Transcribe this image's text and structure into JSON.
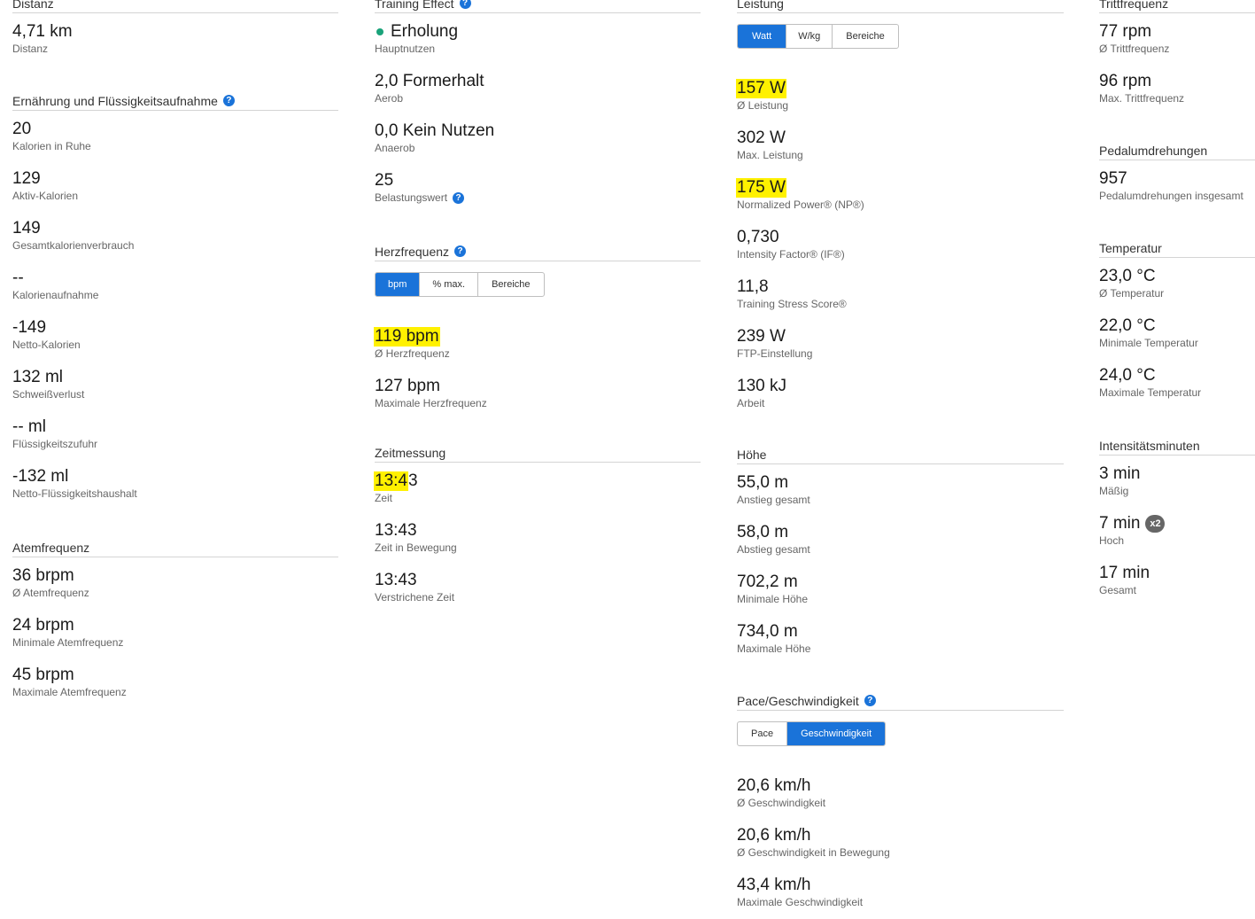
{
  "col1": {
    "distanz": {
      "title": "Distanz",
      "stats": [
        {
          "value": "4,71 km",
          "label": "Distanz"
        }
      ]
    },
    "ernaehrung": {
      "title": "Ernährung und Flüssigkeitsaufnahme",
      "help": "?",
      "stats": [
        {
          "value": "20",
          "label": "Kalorien in Ruhe"
        },
        {
          "value": "129",
          "label": "Aktiv-Kalorien"
        },
        {
          "value": "149",
          "label": "Gesamtkalorienverbrauch"
        },
        {
          "value": "--",
          "label": "Kalorienaufnahme"
        },
        {
          "value": "-149",
          "label": "Netto-Kalorien"
        },
        {
          "value": "132 ml",
          "label": "Schweißverlust"
        },
        {
          "value": "-- ml",
          "label": "Flüssigkeitszufuhr"
        },
        {
          "value": "-132 ml",
          "label": "Netto-Flüssigkeitshaushalt"
        }
      ]
    },
    "atem": {
      "title": "Atemfrequenz",
      "stats": [
        {
          "value": "36 brpm",
          "label": "Ø Atemfrequenz"
        },
        {
          "value": "24 brpm",
          "label": "Minimale Atemfrequenz"
        },
        {
          "value": "45 brpm",
          "label": "Maximale Atemfrequenz"
        }
      ]
    }
  },
  "col2": {
    "training": {
      "title": "Training Effect",
      "help": "?",
      "stats": [
        {
          "value": "Erholung",
          "label": "Hauptnutzen"
        },
        {
          "value": "2,0 Formerhalt",
          "label": "Aerob"
        },
        {
          "value": "0,0 Kein Nutzen",
          "label": "Anaerob"
        },
        {
          "value": "25",
          "label": "Belastungswert",
          "help": "?"
        }
      ]
    },
    "herz": {
      "title": "Herzfrequenz",
      "help": "?",
      "tabs": [
        "bpm",
        "% max.",
        "Bereiche"
      ],
      "stats": [
        {
          "value": "119 bpm",
          "label": "Ø Herzfrequenz"
        },
        {
          "value": "127 bpm",
          "label": "Maximale Herzfrequenz"
        }
      ]
    },
    "zeit": {
      "title": "Zeitmessung",
      "stats": [
        {
          "value_hl": "13:4",
          "value_rest": "3",
          "label": "Zeit"
        },
        {
          "value": "13:43",
          "label": "Zeit in Bewegung"
        },
        {
          "value": "13:43",
          "label": "Verstrichene Zeit"
        }
      ]
    }
  },
  "col3": {
    "leistung": {
      "title": "Leistung",
      "tabs": [
        "Watt",
        "W/kg",
        "Bereiche"
      ],
      "stats": [
        {
          "value": "157 W",
          "label": "Ø Leistung"
        },
        {
          "value": "302 W",
          "label": "Max. Leistung"
        },
        {
          "value": "175 W",
          "label": "Normalized Power® (NP®)"
        },
        {
          "value": "0,730",
          "label": "Intensity Factor® (IF®)"
        },
        {
          "value": "11,8",
          "label": "Training Stress Score®"
        },
        {
          "value": "239 W",
          "label": "FTP-Einstellung"
        },
        {
          "value": "130 kJ",
          "label": "Arbeit"
        }
      ]
    },
    "hoehe": {
      "title": "Höhe",
      "stats": [
        {
          "value": "55,0 m",
          "label": "Anstieg gesamt"
        },
        {
          "value": "58,0 m",
          "label": "Abstieg gesamt"
        },
        {
          "value": "702,2 m",
          "label": "Minimale Höhe"
        },
        {
          "value": "734,0 m",
          "label": "Maximale Höhe"
        }
      ]
    },
    "pace": {
      "title": "Pace/Geschwindigkeit",
      "help": "?",
      "tabs": [
        "Pace",
        "Geschwindigkeit"
      ],
      "stats": [
        {
          "value": "20,6 km/h",
          "label": "Ø Geschwindigkeit"
        },
        {
          "value": "20,6 km/h",
          "label": "Ø Geschwindigkeit in Bewegung"
        },
        {
          "value": "43,4 km/h",
          "label": "Maximale Geschwindigkeit"
        }
      ]
    }
  },
  "col4": {
    "tritt": {
      "title": "Trittfrequenz",
      "stats": [
        {
          "value": "77 rpm",
          "label": "Ø Trittfrequenz"
        },
        {
          "value": "96 rpm",
          "label": "Max. Trittfrequenz"
        }
      ]
    },
    "pedal": {
      "title": "Pedalumdrehungen",
      "stats": [
        {
          "value": "957",
          "label": "Pedalumdrehungen insgesamt"
        }
      ]
    },
    "temp": {
      "title": "Temperatur",
      "stats": [
        {
          "value": "23,0 °C",
          "label": "Ø Temperatur"
        },
        {
          "value": "22,0 °C",
          "label": "Minimale Temperatur"
        },
        {
          "value": "24,0 °C",
          "label": "Maximale Temperatur"
        }
      ]
    },
    "intens": {
      "title": "Intensitätsminuten",
      "stats": [
        {
          "value": "3 min",
          "label": "Mäßig"
        },
        {
          "value": "7 min",
          "label": "Hoch",
          "badge": "x2"
        },
        {
          "value": "17 min",
          "label": "Gesamt"
        }
      ]
    }
  },
  "colors": {
    "accent": "#1a73d9",
    "highlight": "#fff100",
    "positive_dot": "#1aa37a"
  }
}
